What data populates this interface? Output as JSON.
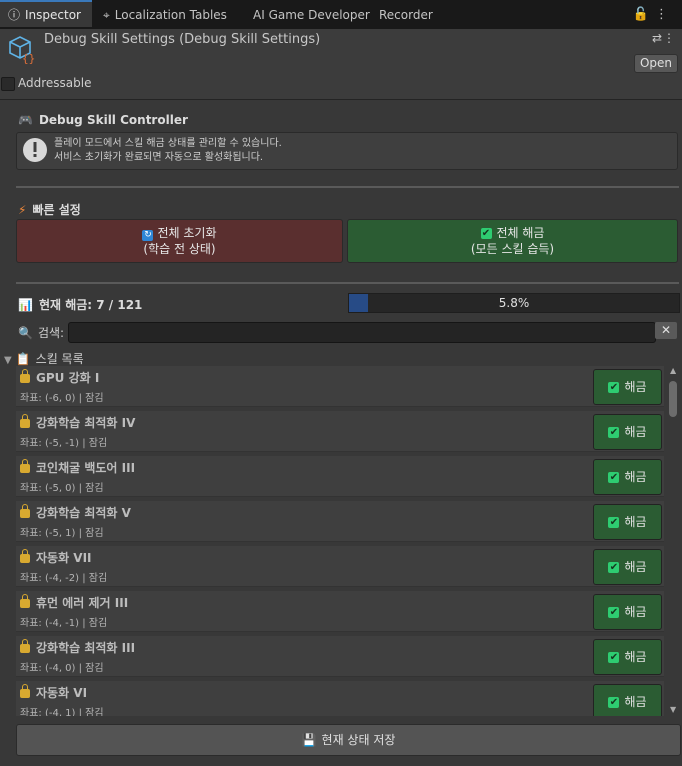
{
  "tabs": [
    {
      "label": "Inspector",
      "icon": "info-icon"
    },
    {
      "label": "Localization Tables",
      "icon": "globe-pin-icon"
    },
    {
      "label": "AI Game Developer",
      "icon": ""
    },
    {
      "label": "Recorder",
      "icon": ""
    }
  ],
  "window_controls": {
    "lock": "🔓",
    "menu": "⋮"
  },
  "header": {
    "title": "Debug Skill Settings (Debug Skill Settings)",
    "open_label": "Open",
    "addressable_label": "Addressable",
    "adjust_icon": "⇄",
    "menu_icon": "⋮"
  },
  "controller": {
    "title": "Debug Skill Controller",
    "help_line1": "플레이 모드에서 스킬 해금 상태를 관리할 수 있습니다.",
    "help_line2": "서비스 초기화가 완료되면 자동으로 활성화됩니다."
  },
  "quick": {
    "title": "빠른 설정",
    "reset_line1": "전체 초기화",
    "reset_line2": "(학습 전 상태)",
    "unlock_line1": "전체 해금",
    "unlock_line2": "(모든 스킬 습득)"
  },
  "status": {
    "label": "현재 해금: 7 / 121",
    "progress_text": "5.8%",
    "progress_fraction": 0.058
  },
  "search": {
    "label": "검색:",
    "value": "",
    "clear": "✕"
  },
  "skills": {
    "title": "스킬 목록",
    "button_label": "해금",
    "items": [
      {
        "name": "GPU 강화 I",
        "coord": "좌표: (-6, 0) | 잠김"
      },
      {
        "name": "강화학습 최적화 IV",
        "coord": "좌표: (-5, -1) | 잠김"
      },
      {
        "name": "코인채굴 백도어 III",
        "coord": "좌표: (-5, 0) | 잠김"
      },
      {
        "name": "강화학습 최적화 V",
        "coord": "좌표: (-5, 1) | 잠김"
      },
      {
        "name": "자동화 VII",
        "coord": "좌표: (-4, -2) | 잠김"
      },
      {
        "name": "휴먼 에러 제거 III",
        "coord": "좌표: (-4, -1) | 잠김"
      },
      {
        "name": "강화학습 최적화 III",
        "coord": "좌표: (-4, 0) | 잠김"
      },
      {
        "name": "자동화 VI",
        "coord": "좌표: (-4, 1) | 잠김"
      }
    ]
  },
  "save_label": "현재 상태 저장",
  "colors": {
    "accent": "#3a79bb",
    "unlock_green": "#2b5c33",
    "reset_red": "#5a2f2f",
    "lock_gold": "#d8a930"
  }
}
